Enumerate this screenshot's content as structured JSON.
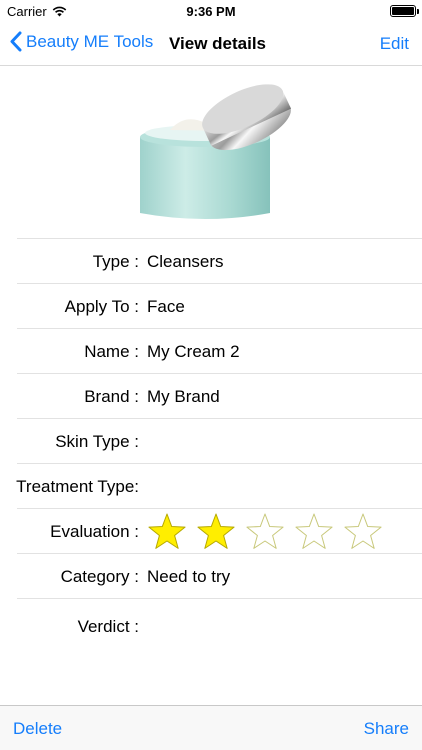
{
  "status": {
    "carrier": "Carrier",
    "time": "9:36 PM",
    "battery_level": 1.0
  },
  "nav": {
    "back_label": "Beauty ME Tools",
    "title": "View details",
    "edit_label": "Edit"
  },
  "product": {
    "image_icon": "cream-jar-image"
  },
  "details": [
    {
      "label": "Type :",
      "value": "Cleansers"
    },
    {
      "label": "Apply To :",
      "value": "Face"
    },
    {
      "label": "Name :",
      "value": "My Cream 2"
    },
    {
      "label": "Brand :",
      "value": "My Brand"
    },
    {
      "label": "Skin Type :",
      "value": ""
    },
    {
      "label": "Treatment Type:",
      "value": ""
    }
  ],
  "evaluation": {
    "label": "Evaluation :",
    "rating": 2,
    "max": 5,
    "filled_color": "#ffee00",
    "empty_color": "#c8c87a"
  },
  "category": {
    "label": "Category :",
    "value": "Need to try"
  },
  "verdict": {
    "label": "Verdict :",
    "value": ""
  },
  "toolbar": {
    "delete_label": "Delete",
    "share_label": "Share"
  },
  "colors": {
    "accent": "#157efb"
  }
}
